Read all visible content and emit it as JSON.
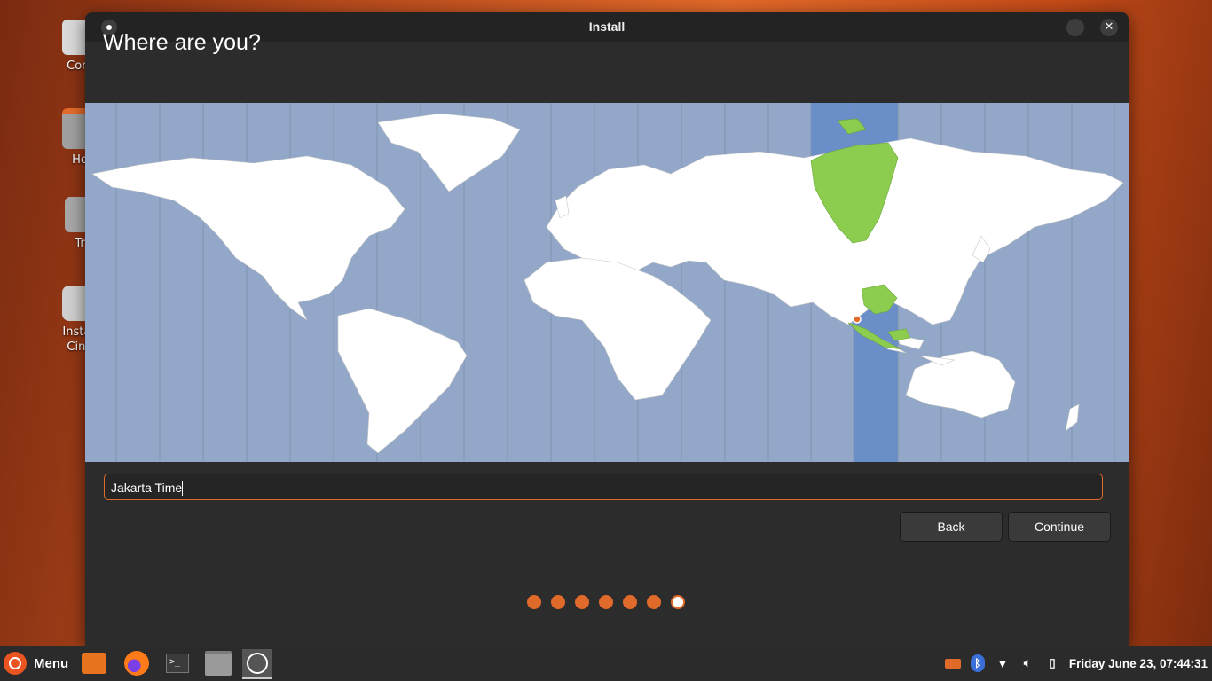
{
  "desktop": {
    "icons": [
      {
        "label": "Com",
        "icon": "computer-icon"
      },
      {
        "label": "Ho",
        "icon": "home-folder-icon"
      },
      {
        "label": "Tr",
        "icon": "trash-icon"
      },
      {
        "label": "Install\nCinn",
        "icon": "installer-icon"
      }
    ]
  },
  "window": {
    "title": "Install",
    "heading": "Where are you?",
    "timezone_value": "Jakarta Time",
    "buttons": {
      "back": "Back",
      "continue": "Continue"
    },
    "progress": {
      "total_steps": 7,
      "current_step": 7
    },
    "map": {
      "selected_zone": "UTC+7",
      "selected_color": "#8ccc4f",
      "band_color": "#6a8fc8",
      "ocean_color": "#93a8c8"
    }
  },
  "panel": {
    "menu_label": "Menu",
    "launchers": [
      "files-orange-icon",
      "firefox-icon",
      "terminal-icon",
      "folder-icon",
      "installer-icon"
    ],
    "tray_icons": [
      "keyboard-icon",
      "bluetooth-icon",
      "wifi-icon",
      "volume-icon",
      "battery-icon"
    ],
    "clock": "Friday June 23, 07:44:31"
  },
  "colors": {
    "accent": "#e06a2a",
    "window_bg": "#2c2c2c",
    "titlebar_bg": "#232323",
    "panel_bg": "#2b2b2b"
  }
}
